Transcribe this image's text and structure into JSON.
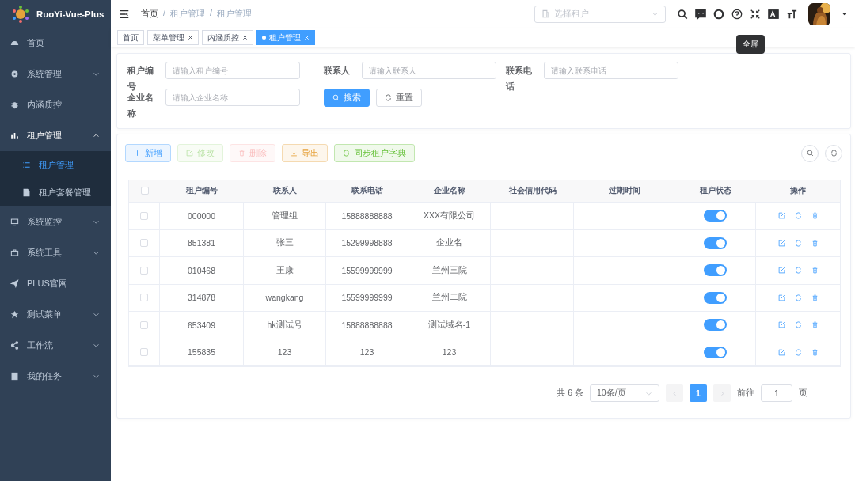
{
  "app": {
    "title": "RuoYi-Vue-Plus"
  },
  "sidebar": {
    "items": [
      {
        "label": "首页",
        "kind": "link"
      },
      {
        "label": "系统管理",
        "kind": "group",
        "expanded": false
      },
      {
        "label": "内涵质控",
        "kind": "link"
      },
      {
        "label": "租户管理",
        "kind": "group",
        "expanded": true,
        "children": [
          {
            "label": "租户管理",
            "selected": true
          },
          {
            "label": "租户套餐管理",
            "selected": false
          }
        ]
      },
      {
        "label": "系统监控",
        "kind": "group",
        "expanded": false
      },
      {
        "label": "系统工具",
        "kind": "group",
        "expanded": false
      },
      {
        "label": "PLUS官网",
        "kind": "link"
      },
      {
        "label": "测试菜单",
        "kind": "group",
        "expanded": false
      },
      {
        "label": "工作流",
        "kind": "group",
        "expanded": false
      },
      {
        "label": "我的任务",
        "kind": "group",
        "expanded": false
      }
    ]
  },
  "navbar": {
    "breadcrumb": [
      "首页",
      "租户管理",
      "租户管理"
    ],
    "breadcrumb_separator": "/",
    "tenant_select": {
      "placeholder": "选择租户"
    },
    "tooltip": "全屏"
  },
  "tags": [
    {
      "label": "首页",
      "selected": false,
      "closable": false
    },
    {
      "label": "菜单管理",
      "selected": false,
      "closable": true
    },
    {
      "label": "内涵质控",
      "selected": false,
      "closable": true
    },
    {
      "label": "租户管理",
      "selected": true,
      "closable": true
    }
  ],
  "search_form": {
    "fields": [
      {
        "label": "租户编号",
        "placeholder": "请输入租户编号"
      },
      {
        "label": "联系人",
        "placeholder": "请输入联系人"
      },
      {
        "label": "联系电话",
        "placeholder": "请输入联系电话"
      },
      {
        "label": "企业名称",
        "placeholder": "请输入企业名称"
      }
    ],
    "buttons": [
      {
        "label": "搜索",
        "kind": "primary"
      },
      {
        "label": "重置",
        "kind": "default"
      }
    ]
  },
  "toolbar": {
    "buttons": [
      {
        "label": "新增",
        "kind": "primary",
        "disabled": false
      },
      {
        "label": "修改",
        "kind": "success",
        "disabled": true
      },
      {
        "label": "删除",
        "kind": "danger",
        "disabled": true
      },
      {
        "label": "导出",
        "kind": "warning",
        "disabled": false
      },
      {
        "label": "同步租户字典",
        "kind": "success",
        "disabled": false
      }
    ]
  },
  "table": {
    "all_selected": false,
    "columns": [
      "租户编号",
      "联系人",
      "联系电话",
      "企业名称",
      "社会信用代码",
      "过期时间",
      "租户状态",
      "操作"
    ],
    "rows": [
      {
        "selected": false,
        "tenant_id": "000000",
        "contact": "管理组",
        "phone": "15888888888",
        "company": "XXX有限公司",
        "enabled": true
      },
      {
        "selected": false,
        "tenant_id": "851381",
        "contact": "张三",
        "phone": "15299998888",
        "company": "企业名",
        "enabled": true
      },
      {
        "selected": false,
        "tenant_id": "010468",
        "contact": "王康",
        "phone": "15599999999",
        "company": "兰州三院",
        "enabled": true
      },
      {
        "selected": false,
        "tenant_id": "314878",
        "contact": "wangkang",
        "phone": "15599999999",
        "company": "兰州二院",
        "enabled": true
      },
      {
        "selected": false,
        "tenant_id": "653409",
        "contact": "hk测试号",
        "phone": "15888888888",
        "company": "测试域名-1",
        "enabled": true
      },
      {
        "selected": false,
        "tenant_id": "155835",
        "contact": "123",
        "phone": "123",
        "company": "123",
        "enabled": true
      }
    ]
  },
  "pagination": {
    "total": "共 6 条",
    "page_size": "10条/页",
    "pages": [
      {
        "label": "1",
        "selected": true
      }
    ],
    "goto_label": "前往",
    "goto_value": "1",
    "goto_suffix": "页"
  }
}
